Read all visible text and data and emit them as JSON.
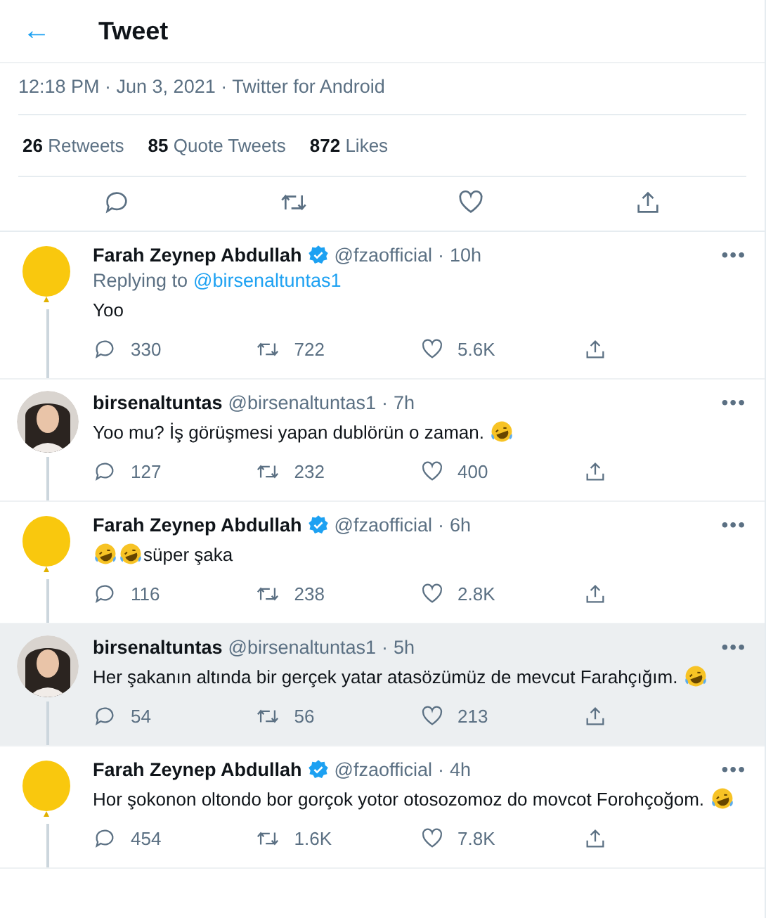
{
  "header": {
    "back": "←",
    "title": "Tweet"
  },
  "meta": "12:18 PM · Jun 3, 2021 · Twitter for Android",
  "stats": [
    {
      "count": "26",
      "label": "Retweets"
    },
    {
      "count": "85",
      "label": "Quote Tweets"
    },
    {
      "count": "872",
      "label": "Likes"
    }
  ],
  "replies": [
    {
      "avatar": {
        "kind": "balloon"
      },
      "name": "Farah Zeynep Abdullah",
      "verified": true,
      "handle": "@fzaofficial",
      "dot": "·",
      "time": "10h",
      "more": "•••",
      "replying_to": {
        "prefix": "Replying to",
        "user": "@birsenaltuntas1"
      },
      "highlighted": false,
      "body": [
        {
          "kind": "text",
          "text": "Yoo"
        }
      ],
      "counts": {
        "reply": "330",
        "retweet": "722",
        "like": "5.6K"
      }
    },
    {
      "avatar": {
        "kind": "picture"
      },
      "name": "birsenaltuntas",
      "verified": false,
      "handle": "@birsenaltuntas1",
      "dot": "·",
      "time": "7h",
      "more": "•••",
      "highlighted": false,
      "body": [
        {
          "kind": "text",
          "text": "Yoo mu? İş görüşmesi yapan dublörün o zaman."
        },
        {
          "kind": "emoji"
        }
      ],
      "counts": {
        "reply": "127",
        "retweet": "232",
        "like": "400"
      }
    },
    {
      "avatar": {
        "kind": "balloon"
      },
      "name": "Farah Zeynep Abdullah",
      "verified": true,
      "handle": "@fzaofficial",
      "dot": "·",
      "time": "6h",
      "more": "•••",
      "highlighted": false,
      "body": [
        {
          "kind": "emoji"
        },
        {
          "kind": "emoji"
        },
        {
          "kind": "text",
          "text": "süper şaka"
        }
      ],
      "counts": {
        "reply": "116",
        "retweet": "238",
        "like": "2.8K"
      }
    },
    {
      "avatar": {
        "kind": "picture"
      },
      "name": "birsenaltuntas",
      "verified": false,
      "handle": "@birsenaltuntas1",
      "dot": "·",
      "time": "5h",
      "more": "•••",
      "highlighted": true,
      "body": [
        {
          "kind": "text",
          "text": "Her şakanın altında bir gerçek yatar atasözümüz de mevcut Farahçığım."
        },
        {
          "kind": "emoji"
        }
      ],
      "counts": {
        "reply": "54",
        "retweet": "56",
        "like": "213"
      }
    },
    {
      "avatar": {
        "kind": "balloon"
      },
      "name": "Farah Zeynep Abdullah",
      "verified": true,
      "handle": "@fzaofficial",
      "dot": "·",
      "time": "4h",
      "more": "•••",
      "highlighted": false,
      "body": [
        {
          "kind": "text",
          "text": "Hor şokonon oltondo bor gorçok yotor otosozomoz do movcot Forohçoğom."
        },
        {
          "kind": "emoji"
        }
      ],
      "counts": {
        "reply": "454",
        "retweet": "1.6K",
        "like": "7.8K"
      }
    }
  ]
}
